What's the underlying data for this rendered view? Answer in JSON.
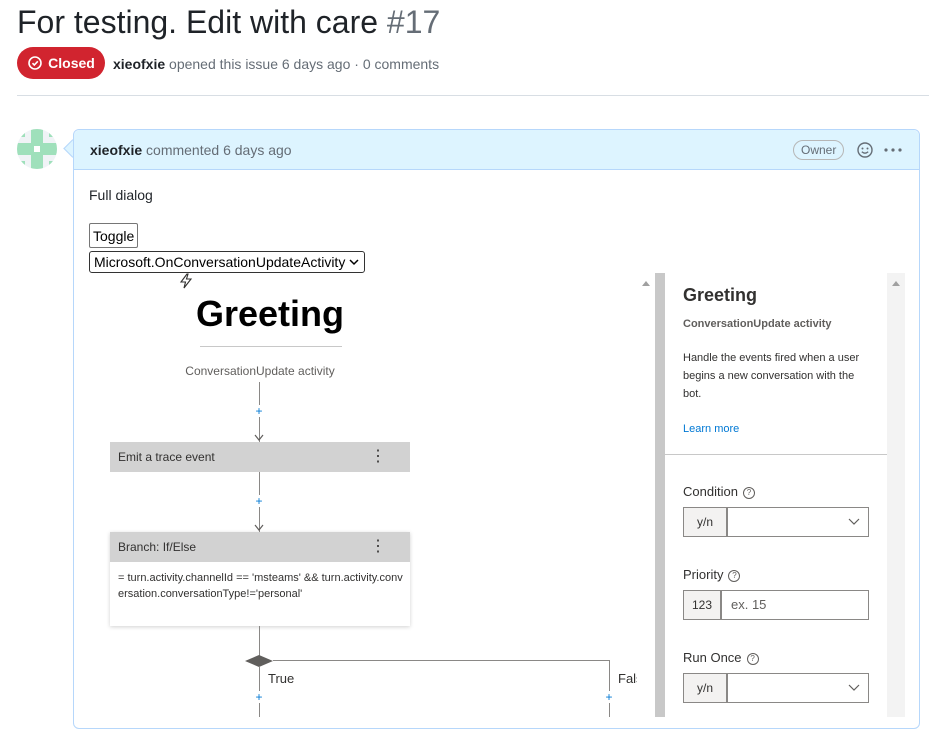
{
  "issue": {
    "title": "For testing. Edit with care",
    "number": "#17",
    "state": "Closed",
    "author": "xieofxie",
    "meta_text": "opened this issue 6 days ago · 0 comments"
  },
  "comment": {
    "author": "xieofxie",
    "meta_text": "commented 6 days ago",
    "role_badge": "Owner",
    "body_text": "Full dialog",
    "toggle_label": "Toggle",
    "event_select_value": "Microsoft.OnConversationUpdateActivity"
  },
  "canvas": {
    "trigger_title": "Greeting",
    "trigger_subtitle": "ConversationUpdate activity",
    "trace_card_label": "Emit a trace event",
    "branch_card_label": "Branch: If/Else",
    "branch_expression": "= turn.activity.channelId == 'msteams' && turn.activity.conversation.conversationType!='personal'",
    "true_label": "True",
    "false_label": "Fals",
    "plus_symbol": "+",
    "kebab_symbol": "⋮"
  },
  "panel": {
    "title": "Greeting",
    "kind": "ConversationUpdate activity",
    "description": "Handle the events fired when a user begins a new conversation with the bot.",
    "learn_more": "Learn more",
    "fields": {
      "condition": {
        "label": "Condition",
        "type": "y/n",
        "value": ""
      },
      "priority": {
        "label": "Priority",
        "type": "123",
        "placeholder": "ex. 15"
      },
      "run_once": {
        "label": "Run Once",
        "type": "y/n",
        "value": ""
      }
    },
    "help_symbol": "?"
  },
  "colors": {
    "closed_red": "#d1242f",
    "comment_header_bg": "#ddf4ff",
    "link_blue": "#0078d4",
    "card_gray": "#d2d2d2"
  },
  "icons": [
    "closed-issue-icon",
    "avatar-identicon",
    "smiley-icon",
    "kebab-horizontal-icon",
    "trigger-lightning-icon",
    "plus-icon",
    "diamond-icon",
    "help-icon",
    "chevron-down-icon"
  ]
}
